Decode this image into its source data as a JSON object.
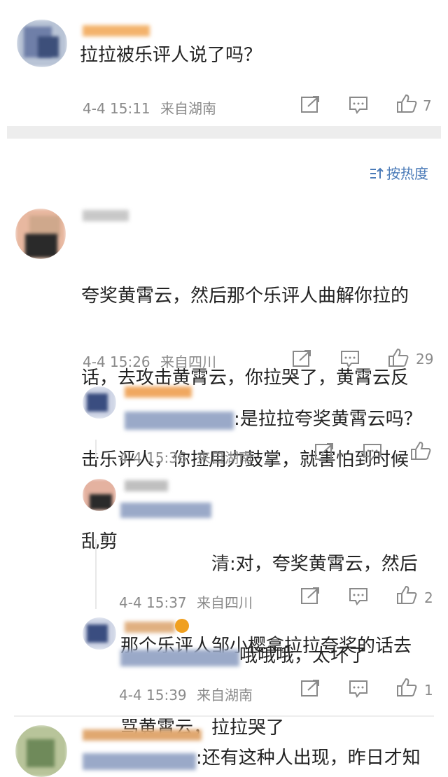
{
  "top_comment": {
    "text": "拉拉被乐评人说了吗？",
    "time": "4-4 15:11",
    "location": "来自湖南",
    "likes": "7"
  },
  "sort_label": "按热度",
  "main_comment": {
    "lines": [
      "夸奖黄霄云，然后那个乐评人曲解你拉的",
      "话，去攻击黄霄云，你拉哭了，黄霄云反",
      "击乐评人，你拉用力鼓掌，就害怕到时候",
      "乱剪"
    ],
    "time": "4-4 15:26",
    "location": "来自四川",
    "likes": "29"
  },
  "replies": [
    {
      "text": ":是拉拉夸奖黄霄云吗？",
      "time": "4-4 15:36",
      "location": "来自湖南",
      "likes": ""
    },
    {
      "text_lines": [
        ":对，夸奖黄霄云，然后",
        "那个乐评人邹小樱拿拉拉夸奖的话去",
        "骂黄霄云，拉拉哭了"
      ],
      "name_fragment": "清",
      "time": "4-4 15:37",
      "location": "来自四川",
      "likes": "2"
    },
    {
      "text": "哦哦哦，太坏了",
      "time": "4-4 15:39",
      "location": "来自湖南",
      "likes": "1"
    }
  ],
  "bottom_comment": {
    "text": ":还有这种人出现，昨日才知"
  },
  "icons": {
    "share": "share-icon",
    "comment": "comment-icon",
    "like": "like-icon",
    "sort": "sort-icon"
  },
  "colors": {
    "meta": "#8a8a8a",
    "sort_accent": "#4b7bb8",
    "divider": "#ededed"
  }
}
